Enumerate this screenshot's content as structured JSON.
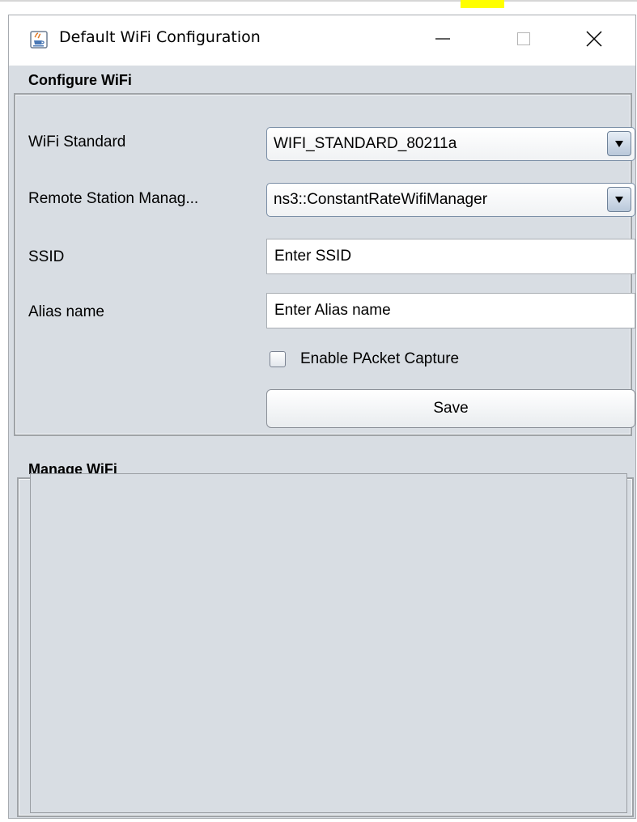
{
  "window": {
    "title": "Default WiFi Configuration",
    "icon": "java-cup-icon",
    "controls": {
      "minimize": "minimize-icon",
      "maximize": "maximize-icon",
      "close": "close-icon"
    }
  },
  "configure": {
    "heading": "Configure WiFi",
    "wifi_standard": {
      "label": "WiFi Standard",
      "value": "WIFI_STANDARD_80211a"
    },
    "remote_station_manager": {
      "label": "Remote Station Manag...",
      "value": "ns3::ConstantRateWifiManager"
    },
    "ssid": {
      "label": "SSID",
      "value": "Enter SSID"
    },
    "alias": {
      "label": "Alias name",
      "value": "Enter Alias name"
    },
    "packet_capture": {
      "label": "Enable PAcket Capture",
      "checked": false
    },
    "save_label": "Save"
  },
  "manage": {
    "heading": "Manage WiFi"
  },
  "colors": {
    "window_background": "#d8dde3",
    "titlebar_background": "#ffffff",
    "highlight": "#ffff00",
    "combo_border": "#7a8ea6"
  }
}
